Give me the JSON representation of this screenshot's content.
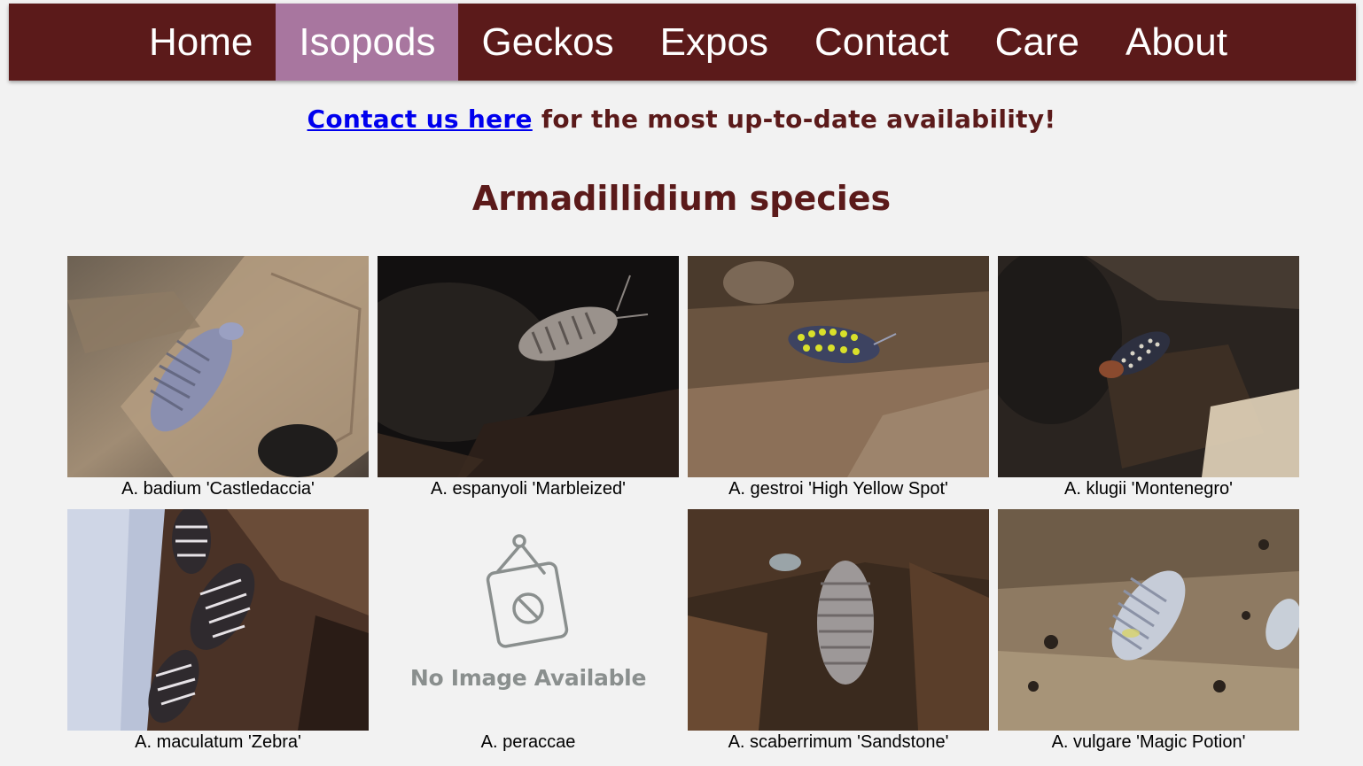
{
  "nav": {
    "items": [
      {
        "label": "Home",
        "active": false
      },
      {
        "label": "Isopods",
        "active": true
      },
      {
        "label": "Geckos",
        "active": false
      },
      {
        "label": "Expos",
        "active": false
      },
      {
        "label": "Contact",
        "active": false
      },
      {
        "label": "Care",
        "active": false
      },
      {
        "label": "About",
        "active": false
      }
    ]
  },
  "availability": {
    "link_text": "Contact us here",
    "rest_text": " for the most up-to-date availability!"
  },
  "section": {
    "title": "Armadillidium species"
  },
  "species": [
    {
      "caption": "A. badium 'Castledaccia'",
      "image": "photo-badium"
    },
    {
      "caption": "A. espanyoli 'Marbleized'",
      "image": "photo-espanyoli"
    },
    {
      "caption": "A. gestroi 'High Yellow Spot'",
      "image": "photo-gestroi"
    },
    {
      "caption": "A. klugii 'Montenegro'",
      "image": "photo-klugii"
    },
    {
      "caption": "A. maculatum 'Zebra'",
      "image": "photo-maculatum"
    },
    {
      "caption": "A. peraccae",
      "image": "no-image-placeholder",
      "placeholder_text": "No Image Available"
    },
    {
      "caption": "A. scaberrimum 'Sandstone'",
      "image": "photo-scaberrimum"
    },
    {
      "caption": "A. vulgare 'Magic Potion'",
      "image": "photo-vulgare"
    }
  ],
  "colors": {
    "nav_bg": "#5b1a1a",
    "nav_active": "#a8769f",
    "text_accent": "#5b1a1a",
    "link": "#0000ee",
    "page_bg": "#f2f2f2"
  }
}
